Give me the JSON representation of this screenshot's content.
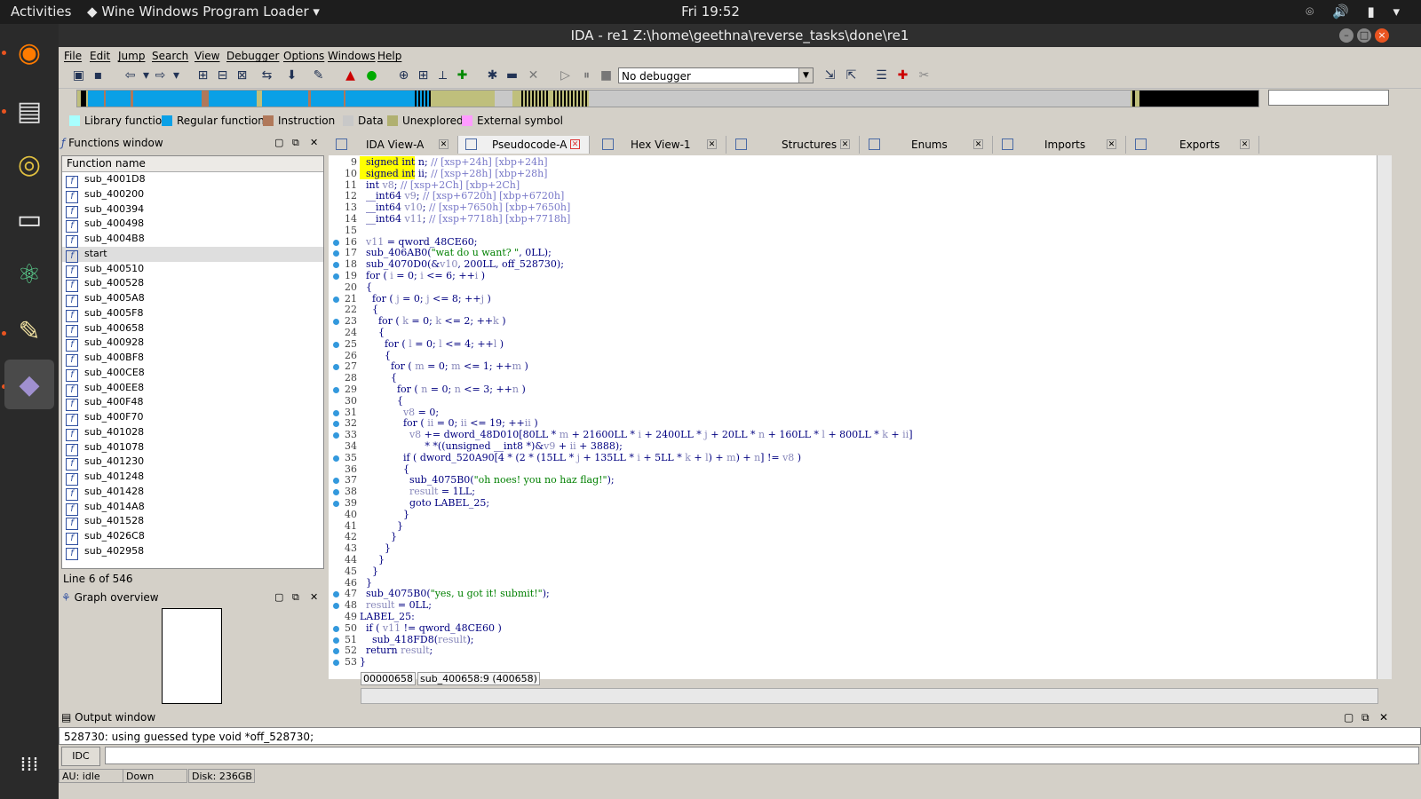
{
  "system": {
    "activities": "Activities",
    "app_name": "Wine Windows Program Loader",
    "clock": "Fri 19:52",
    "tray": "⌾ 🔊 ▮ ▾"
  },
  "window": {
    "title": "IDA - re1 Z:\\home\\geethna\\reverse_tasks\\done\\re1"
  },
  "menu": [
    "File",
    "Edit",
    "Jump",
    "Search",
    "View",
    "Debugger",
    "Options",
    "Windows",
    "Help"
  ],
  "toolbar": {
    "debugger_select": "No debugger"
  },
  "legend": [
    {
      "label": "Library function",
      "color": "#a8ffff"
    },
    {
      "label": "Regular function",
      "color": "#0aa0e6"
    },
    {
      "label": "Instruction",
      "color": "#b0785a"
    },
    {
      "label": "Data",
      "color": "#c8c8c8"
    },
    {
      "label": "Unexplored",
      "color": "#b0b070"
    },
    {
      "label": "External symbol",
      "color": "#ff9cff"
    }
  ],
  "functions_window": {
    "title": "Functions window",
    "column_header": "Function name",
    "rows": [
      "sub_4001D8",
      "sub_400200",
      "sub_400394",
      "sub_400498",
      "sub_4004B8",
      "start",
      "sub_400510",
      "sub_400528",
      "sub_4005A8",
      "sub_4005F8",
      "sub_400658",
      "sub_400928",
      "sub_400BF8",
      "sub_400CE8",
      "sub_400EE8",
      "sub_400F48",
      "sub_400F70",
      "sub_401028",
      "sub_401078",
      "sub_401230",
      "sub_401248",
      "sub_401428",
      "sub_4014A8",
      "sub_401528",
      "sub_4026C8",
      "sub_402958"
    ],
    "selected_index": 5,
    "line_info": "Line 6 of 546"
  },
  "graph_overview": {
    "title": "Graph overview"
  },
  "tabs": [
    {
      "label": "IDA View-A"
    },
    {
      "label": "Pseudocode-A"
    },
    {
      "label": "Hex View-1"
    },
    {
      "label": "Structures"
    },
    {
      "label": "Enums"
    },
    {
      "label": "Imports"
    },
    {
      "label": "Exports"
    }
  ],
  "code_lines": [
    {
      "n": "9",
      "bp": false,
      "segs": [
        [
          "hl",
          "  signed int"
        ],
        [
          "n",
          " n; "
        ],
        [
          "cm",
          "// [xsp+24h] [xbp+24h]"
        ]
      ]
    },
    {
      "n": "10",
      "bp": false,
      "segs": [
        [
          "hl",
          "  signed int"
        ],
        [
          "n",
          " ii; "
        ],
        [
          "cm",
          "// [xsp+28h] [xbp+28h]"
        ]
      ]
    },
    {
      "n": "11",
      "bp": false,
      "segs": [
        [
          "n",
          "  int "
        ],
        [
          "gr",
          "v8"
        ],
        [
          "n",
          "; "
        ],
        [
          "cm",
          "// [xsp+2Ch] [xbp+2Ch]"
        ]
      ]
    },
    {
      "n": "12",
      "bp": false,
      "segs": [
        [
          "n",
          "  __int64 "
        ],
        [
          "gr",
          "v9"
        ],
        [
          "n",
          "; "
        ],
        [
          "cm",
          "// [xsp+6720h] [xbp+6720h]"
        ]
      ]
    },
    {
      "n": "13",
      "bp": false,
      "segs": [
        [
          "n",
          "  __int64 "
        ],
        [
          "gr",
          "v10"
        ],
        [
          "n",
          "; "
        ],
        [
          "cm",
          "// [xsp+7650h] [xbp+7650h]"
        ]
      ]
    },
    {
      "n": "14",
      "bp": false,
      "segs": [
        [
          "n",
          "  __int64 "
        ],
        [
          "gr",
          "v11"
        ],
        [
          "n",
          "; "
        ],
        [
          "cm",
          "// [xsp+7718h] [xbp+7718h]"
        ]
      ]
    },
    {
      "n": "15",
      "bp": false,
      "segs": [
        [
          "n",
          ""
        ]
      ]
    },
    {
      "n": "16",
      "bp": true,
      "segs": [
        [
          "n",
          "  "
        ],
        [
          "gr",
          "v11"
        ],
        [
          "n",
          " = qword_48CE60;"
        ]
      ]
    },
    {
      "n": "17",
      "bp": true,
      "segs": [
        [
          "n",
          "  sub_406AB0("
        ],
        [
          "st",
          "\"wat do u want? \""
        ],
        [
          "n",
          ", 0LL);"
        ]
      ]
    },
    {
      "n": "18",
      "bp": true,
      "segs": [
        [
          "n",
          "  sub_4070D0(&"
        ],
        [
          "gr",
          "v10"
        ],
        [
          "n",
          ", 200LL, off_528730);"
        ]
      ]
    },
    {
      "n": "19",
      "bp": true,
      "segs": [
        [
          "n",
          "  for ( "
        ],
        [
          "gr",
          "i"
        ],
        [
          "n",
          " = 0; "
        ],
        [
          "gr",
          "i"
        ],
        [
          "n",
          " <= 6; ++"
        ],
        [
          "gr",
          "i"
        ],
        [
          "n",
          " )"
        ]
      ]
    },
    {
      "n": "20",
      "bp": false,
      "segs": [
        [
          "n",
          "  {"
        ]
      ]
    },
    {
      "n": "21",
      "bp": true,
      "segs": [
        [
          "n",
          "    for ( "
        ],
        [
          "gr",
          "j"
        ],
        [
          "n",
          " = 0; "
        ],
        [
          "gr",
          "j"
        ],
        [
          "n",
          " <= 8; ++"
        ],
        [
          "gr",
          "j"
        ],
        [
          "n",
          " )"
        ]
      ]
    },
    {
      "n": "22",
      "bp": false,
      "segs": [
        [
          "n",
          "    {"
        ]
      ]
    },
    {
      "n": "23",
      "bp": true,
      "segs": [
        [
          "n",
          "      for ( "
        ],
        [
          "gr",
          "k"
        ],
        [
          "n",
          " = 0; "
        ],
        [
          "gr",
          "k"
        ],
        [
          "n",
          " <= 2; ++"
        ],
        [
          "gr",
          "k"
        ],
        [
          "n",
          " )"
        ]
      ]
    },
    {
      "n": "24",
      "bp": false,
      "segs": [
        [
          "n",
          "      {"
        ]
      ]
    },
    {
      "n": "25",
      "bp": true,
      "segs": [
        [
          "n",
          "        for ( "
        ],
        [
          "gr",
          "l"
        ],
        [
          "n",
          " = 0; "
        ],
        [
          "gr",
          "l"
        ],
        [
          "n",
          " <= 4; ++"
        ],
        [
          "gr",
          "l"
        ],
        [
          "n",
          " )"
        ]
      ]
    },
    {
      "n": "26",
      "bp": false,
      "segs": [
        [
          "n",
          "        {"
        ]
      ]
    },
    {
      "n": "27",
      "bp": true,
      "segs": [
        [
          "n",
          "          for ( "
        ],
        [
          "gr",
          "m"
        ],
        [
          "n",
          " = 0; "
        ],
        [
          "gr",
          "m"
        ],
        [
          "n",
          " <= 1; ++"
        ],
        [
          "gr",
          "m"
        ],
        [
          "n",
          " )"
        ]
      ]
    },
    {
      "n": "28",
      "bp": false,
      "segs": [
        [
          "n",
          "          {"
        ]
      ]
    },
    {
      "n": "29",
      "bp": true,
      "segs": [
        [
          "n",
          "            for ( "
        ],
        [
          "gr",
          "n"
        ],
        [
          "n",
          " = 0; "
        ],
        [
          "gr",
          "n"
        ],
        [
          "n",
          " <= 3; ++"
        ],
        [
          "gr",
          "n"
        ],
        [
          "n",
          " )"
        ]
      ]
    },
    {
      "n": "30",
      "bp": false,
      "segs": [
        [
          "n",
          "            {"
        ]
      ]
    },
    {
      "n": "31",
      "bp": true,
      "segs": [
        [
          "n",
          "              "
        ],
        [
          "gr",
          "v8"
        ],
        [
          "n",
          " = 0;"
        ]
      ]
    },
    {
      "n": "32",
      "bp": true,
      "segs": [
        [
          "n",
          "              for ( "
        ],
        [
          "gr",
          "ii"
        ],
        [
          "n",
          " = 0; "
        ],
        [
          "gr",
          "ii"
        ],
        [
          "n",
          " <= 19; ++"
        ],
        [
          "gr",
          "ii"
        ],
        [
          "n",
          " )"
        ]
      ]
    },
    {
      "n": "33",
      "bp": true,
      "segs": [
        [
          "n",
          "                "
        ],
        [
          "gr",
          "v8"
        ],
        [
          "n",
          " += dword_48D010[80LL * "
        ],
        [
          "gr",
          "m"
        ],
        [
          "n",
          " + 21600LL * "
        ],
        [
          "gr",
          "i"
        ],
        [
          "n",
          " + 2400LL * "
        ],
        [
          "gr",
          "j"
        ],
        [
          "n",
          " + 20LL * "
        ],
        [
          "gr",
          "n"
        ],
        [
          "n",
          " + 160LL * "
        ],
        [
          "gr",
          "l"
        ],
        [
          "n",
          " + 800LL * "
        ],
        [
          "gr",
          "k"
        ],
        [
          "n",
          " + "
        ],
        [
          "gr",
          "ii"
        ],
        [
          "n",
          "]"
        ]
      ]
    },
    {
      "n": "34",
      "bp": false,
      "segs": [
        [
          "n",
          "                     * *((unsigned __int8 *)&"
        ],
        [
          "gr",
          "v9"
        ],
        [
          "n",
          " + "
        ],
        [
          "gr",
          "ii"
        ],
        [
          "n",
          " + 3888);"
        ]
      ]
    },
    {
      "n": "35",
      "bp": true,
      "segs": [
        [
          "n",
          "              if ( dword_520A90[4 * (2 * (15LL * "
        ],
        [
          "gr",
          "j"
        ],
        [
          "n",
          " + 135LL * "
        ],
        [
          "gr",
          "i"
        ],
        [
          "n",
          " + 5LL * "
        ],
        [
          "gr",
          "k"
        ],
        [
          "n",
          " + "
        ],
        [
          "gr",
          "l"
        ],
        [
          "n",
          ") + "
        ],
        [
          "gr",
          "m"
        ],
        [
          "n",
          ") + "
        ],
        [
          "gr",
          "n"
        ],
        [
          "n",
          "] != "
        ],
        [
          "gr",
          "v8"
        ],
        [
          "n",
          " )"
        ]
      ]
    },
    {
      "n": "36",
      "bp": false,
      "segs": [
        [
          "n",
          "              {"
        ]
      ]
    },
    {
      "n": "37",
      "bp": true,
      "segs": [
        [
          "n",
          "                sub_4075B0("
        ],
        [
          "st",
          "\"oh noes! you no haz flag!\""
        ],
        [
          "n",
          ");"
        ]
      ]
    },
    {
      "n": "38",
      "bp": true,
      "segs": [
        [
          "n",
          "                "
        ],
        [
          "gr",
          "result"
        ],
        [
          "n",
          " = 1LL;"
        ]
      ]
    },
    {
      "n": "39",
      "bp": true,
      "segs": [
        [
          "n",
          "                goto LABEL_25;"
        ]
      ]
    },
    {
      "n": "40",
      "bp": false,
      "segs": [
        [
          "n",
          "              }"
        ]
      ]
    },
    {
      "n": "41",
      "bp": false,
      "segs": [
        [
          "n",
          "            }"
        ]
      ]
    },
    {
      "n": "42",
      "bp": false,
      "segs": [
        [
          "n",
          "          }"
        ]
      ]
    },
    {
      "n": "43",
      "bp": false,
      "segs": [
        [
          "n",
          "        }"
        ]
      ]
    },
    {
      "n": "44",
      "bp": false,
      "segs": [
        [
          "n",
          "      }"
        ]
      ]
    },
    {
      "n": "45",
      "bp": false,
      "segs": [
        [
          "n",
          "    }"
        ]
      ]
    },
    {
      "n": "46",
      "bp": false,
      "segs": [
        [
          "n",
          "  }"
        ]
      ]
    },
    {
      "n": "47",
      "bp": true,
      "segs": [
        [
          "n",
          "  sub_4075B0("
        ],
        [
          "st",
          "\"yes, u got it! submit!\""
        ],
        [
          "n",
          ");"
        ]
      ]
    },
    {
      "n": "48",
      "bp": true,
      "segs": [
        [
          "n",
          "  "
        ],
        [
          "gr",
          "result"
        ],
        [
          "n",
          " = 0LL;"
        ]
      ]
    },
    {
      "n": "49",
      "bp": false,
      "segs": [
        [
          "n",
          "LABEL_25:"
        ]
      ]
    },
    {
      "n": "50",
      "bp": true,
      "segs": [
        [
          "n",
          "  if ( "
        ],
        [
          "gr",
          "v11"
        ],
        [
          "n",
          " != qword_48CE60 )"
        ]
      ]
    },
    {
      "n": "51",
      "bp": true,
      "segs": [
        [
          "n",
          "    sub_418FD8("
        ],
        [
          "gr",
          "result"
        ],
        [
          "n",
          ");"
        ]
      ]
    },
    {
      "n": "52",
      "bp": true,
      "segs": [
        [
          "n",
          "  return "
        ],
        [
          "gr",
          "result"
        ],
        [
          "n",
          ";"
        ]
      ]
    },
    {
      "n": "53",
      "bp": true,
      "segs": [
        [
          "n",
          "}"
        ]
      ]
    }
  ],
  "code_status": {
    "address": "00000658",
    "location": "sub_400658:9 (400658)"
  },
  "output_window": {
    "title": "Output window",
    "text": "528730: using guessed type void *off_528730;",
    "idc_button": "IDC"
  },
  "statusbar": {
    "au": "AU:  idle",
    "direction": "Down",
    "disk": "Disk: 236GB"
  }
}
